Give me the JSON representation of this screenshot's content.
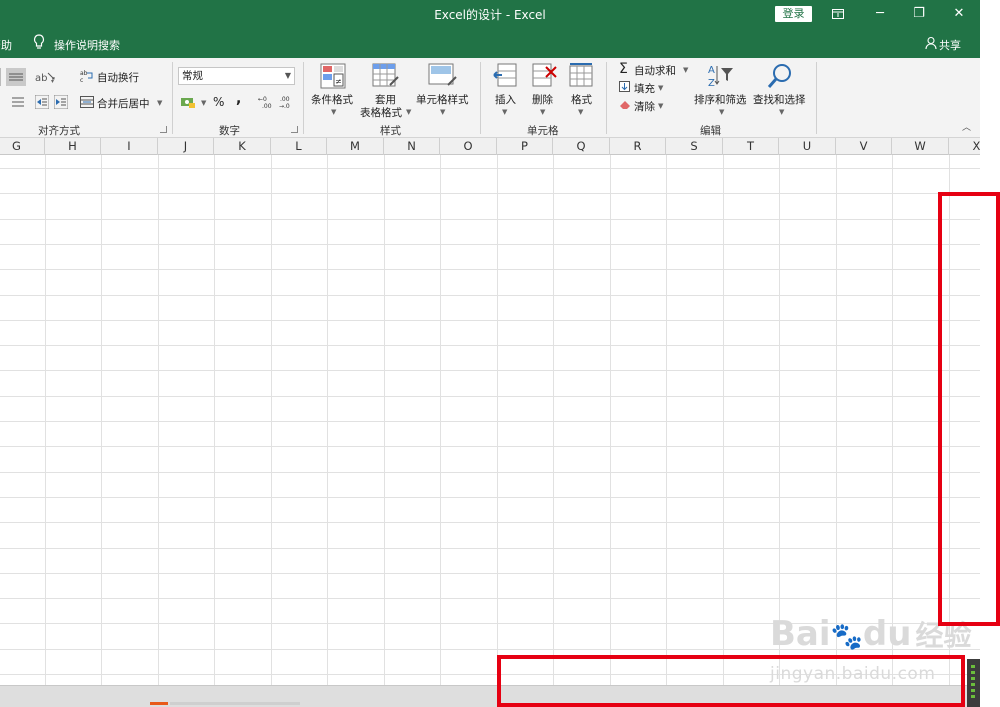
{
  "window": {
    "title": "Excel的设计  -  Excel",
    "login_label": "登录",
    "restore_label": "🗗",
    "minimize_label": "─",
    "maximize_label": "❐",
    "close_label": "✕"
  },
  "tellbar": {
    "help_label": "帮助",
    "tell_me": "操作说明搜索",
    "share_label": "共享"
  },
  "ribbon": {
    "alignment": {
      "wrap_text": "自动换行",
      "merge_center": "合并后居中",
      "label": "对齐方式"
    },
    "number": {
      "format_value": "常规",
      "percent": "%",
      "comma": ",",
      "label": "数字"
    },
    "styles": {
      "conditional": "条件格式",
      "table_line1": "套用",
      "table_line2": "表格格式",
      "cell_styles": "单元格样式",
      "label": "样式"
    },
    "cells": {
      "insert": "插入",
      "delete": "删除",
      "format": "格式",
      "label": "单元格"
    },
    "editing": {
      "autosum": "自动求和",
      "fill": "填充",
      "clear": "清除",
      "sort_filter": "排序和筛选",
      "find_select": "查找和选择",
      "label": "编辑"
    }
  },
  "columns": [
    "G",
    "H",
    "I",
    "J",
    "K",
    "L",
    "M",
    "N",
    "O",
    "P",
    "Q",
    "R",
    "S",
    "T",
    "U",
    "V",
    "W",
    "X"
  ],
  "watermark": {
    "brand": "Bai",
    "brand2": "du",
    "brand_cn": "经验",
    "url": "jingyan.baidu.com"
  },
  "colors": {
    "excel_green": "#217346",
    "annotation_red": "#e60012"
  }
}
